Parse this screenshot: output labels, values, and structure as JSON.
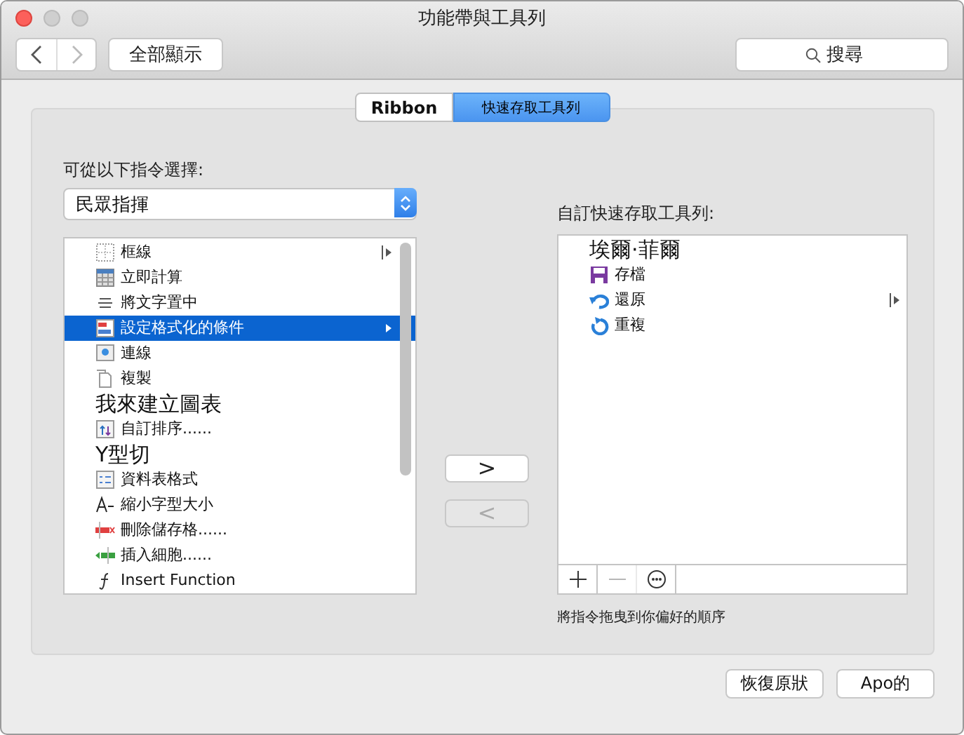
{
  "window": {
    "title": "功能帶與工具列"
  },
  "toolbar": {
    "show_all": "全部顯示",
    "search": {
      "placeholder": "搜尋"
    }
  },
  "tabs": [
    {
      "label": "Ribbon",
      "selected": false
    },
    {
      "label": "快速存取工具列",
      "selected": true
    }
  ],
  "source": {
    "label": "可從以下指令選擇:",
    "value": "民眾指揮"
  },
  "commands": [
    {
      "label": "框線",
      "kind": "grid",
      "submenu": true,
      "selected": false,
      "large": false
    },
    {
      "label": "立即計算",
      "kind": "calc",
      "submenu": false,
      "selected": false,
      "large": false
    },
    {
      "label": "將文字置中",
      "kind": "center",
      "submenu": false,
      "selected": false,
      "large": false
    },
    {
      "label": "設定格式化的條件",
      "kind": "format",
      "submenu": true,
      "selected": true,
      "large": false
    },
    {
      "label": "連線",
      "kind": "link",
      "submenu": false,
      "selected": false,
      "large": false
    },
    {
      "label": "複製",
      "kind": "copy",
      "submenu": false,
      "selected": false,
      "large": false
    },
    {
      "label": "我來建立圖表",
      "kind": "none",
      "submenu": false,
      "selected": false,
      "large": true
    },
    {
      "label": "自訂排序......",
      "kind": "sort",
      "submenu": false,
      "selected": false,
      "large": false
    },
    {
      "label": "Y型切",
      "kind": "none",
      "submenu": false,
      "selected": false,
      "large": true
    },
    {
      "label": "資料表格式",
      "kind": "table",
      "submenu": false,
      "selected": false,
      "large": false
    },
    {
      "label": "縮小字型大小",
      "kind": "shrink",
      "submenu": false,
      "selected": false,
      "large": false
    },
    {
      "label": "刪除儲存格......",
      "kind": "delete",
      "submenu": false,
      "selected": false,
      "large": false
    },
    {
      "label": "插入細胞......",
      "kind": "insert",
      "submenu": false,
      "selected": false,
      "large": false
    },
    {
      "label": "Insert Function",
      "kind": "function",
      "submenu": false,
      "selected": false,
      "large": false
    }
  ],
  "move_buttons": [
    {
      "label": ">",
      "disabled": false
    },
    {
      "label": "<",
      "disabled": true
    }
  ],
  "quick_access": {
    "label": "自訂快速存取工具列:",
    "items": [
      {
        "label": "埃爾·菲爾",
        "kind": "none",
        "submenu": false,
        "large": true
      },
      {
        "label": "存檔",
        "kind": "save",
        "submenu": false,
        "large": false
      },
      {
        "label": "還原",
        "kind": "undo",
        "submenu": true,
        "large": false
      },
      {
        "label": "重複",
        "kind": "redo",
        "submenu": false,
        "large": false
      }
    ],
    "list_buttons": [
      {
        "kind": "add",
        "disabled": false
      },
      {
        "kind": "remove",
        "disabled": true
      },
      {
        "kind": "more",
        "disabled": false
      }
    ],
    "hint": "將指令拖曳到你偏好的順序"
  },
  "footer_buttons": [
    "恢復原狀",
    "Apo的"
  ]
}
